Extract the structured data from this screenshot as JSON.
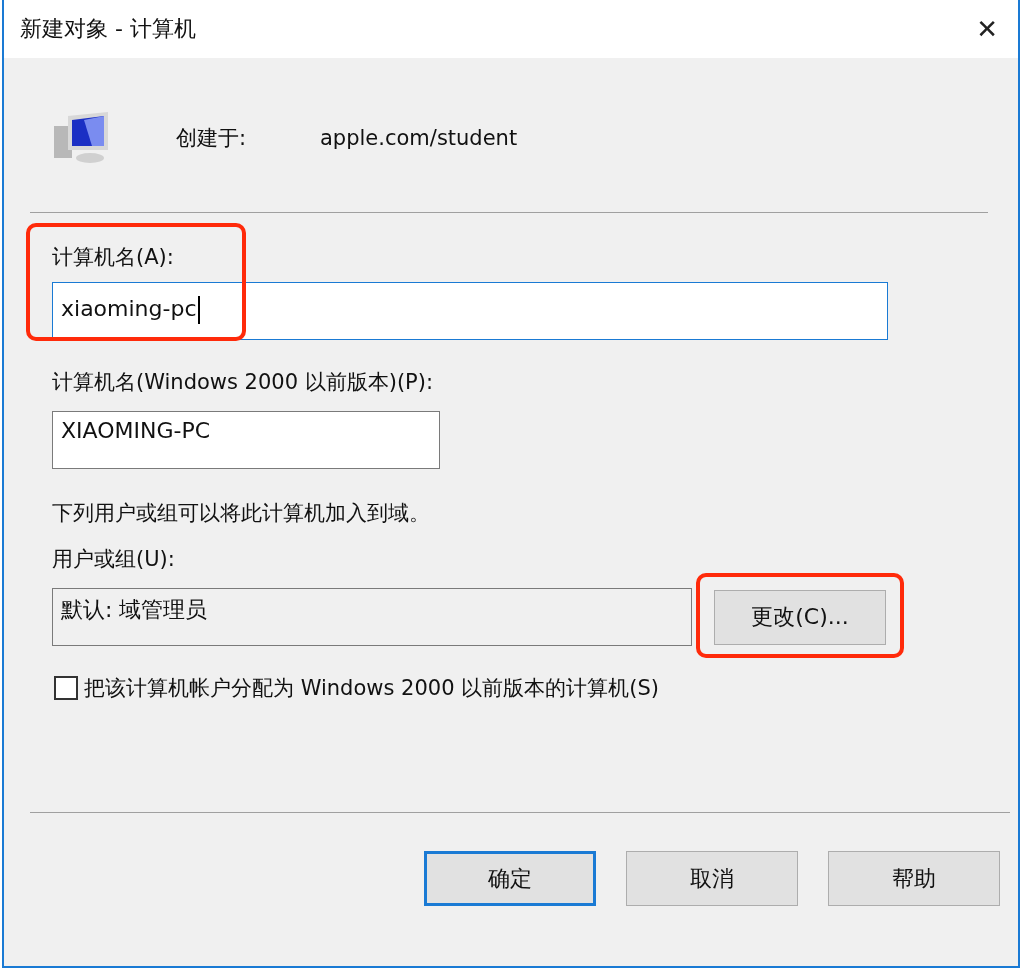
{
  "window": {
    "title": "新建对象 - 计算机",
    "close": "✕"
  },
  "created_in": {
    "label": "创建于:",
    "value": "apple.com/student"
  },
  "computer_name": {
    "label": "计算机名(A):",
    "value": "xiaoming-pc",
    "focused": true,
    "highlighted": true
  },
  "legacy_name": {
    "label": "计算机名(Windows 2000 以前版本)(P):",
    "value": "XIAOMING-PC"
  },
  "join_note": "下列用户或组可以将此计算机加入到域。",
  "user_group": {
    "label": "用户或组(U):",
    "value": "默认: 域管理员",
    "button": "更改(C)...",
    "highlighted": true
  },
  "assign_legacy": {
    "label": "把该计算机帐户分配为 Windows 2000 以前版本的计算机(S)",
    "checked": false
  },
  "buttons": [
    {
      "label": "确定",
      "default": true
    },
    {
      "label": "取消",
      "default": false
    },
    {
      "label": "帮助",
      "default": false
    }
  ]
}
